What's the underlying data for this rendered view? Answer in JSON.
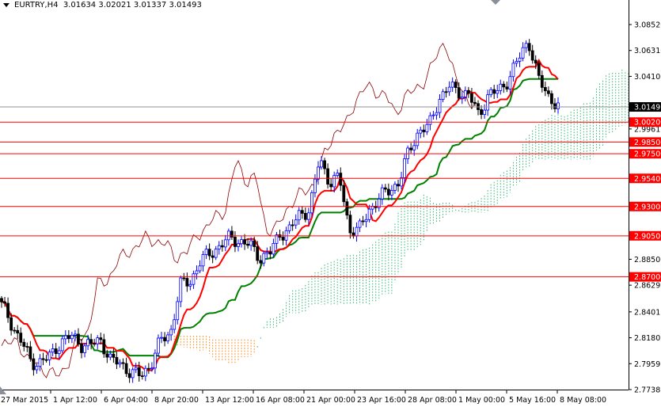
{
  "header": {
    "symbol": "EURTRY,H4",
    "open": "3.01634",
    "high": "3.02021",
    "low": "3.01337",
    "close": "3.01493"
  },
  "chart_data": {
    "type": "candlestick",
    "title": "EURTRY,H4",
    "ylim": [
      2.77385,
      3.0852
    ],
    "y_ticks": [
      "3.08520",
      "3.06310",
      "3.04100",
      "2.99615",
      "2.88500",
      "2.86290",
      "2.84015",
      "2.81805",
      "2.79595",
      "2.77385"
    ],
    "x_ticks": [
      "27 Mar 2015",
      "1 Apr 12:00",
      "6 Apr 04:00",
      "8 Apr 20:00",
      "13 Apr 12:00",
      "16 Apr 08:00",
      "21 Apr 00:00",
      "23 Apr 16:00",
      "28 Apr 08:00",
      "1 May 00:00",
      "5 May 16:00",
      "8 May 08:00"
    ],
    "close_path": [
      2.8461,
      2.8292,
      2.8157,
      2.7955,
      2.7988,
      2.8022,
      2.8157,
      2.8191,
      2.8123,
      2.8123,
      2.8157,
      2.7988,
      2.7955,
      2.7887,
      2.7853,
      2.7955,
      2.8157,
      2.8225,
      2.863,
      2.8664,
      2.8833,
      2.89,
      2.8968,
      2.9035,
      2.9001,
      2.8968,
      2.8866,
      2.89,
      2.9069,
      2.9103,
      2.9238,
      2.9272,
      2.9711,
      2.9508,
      2.9542,
      2.9103,
      2.9103,
      2.9272,
      2.9373,
      2.944,
      2.9508,
      2.9778,
      2.9947,
      2.9981,
      3.0217,
      3.0318,
      3.0285,
      3.0251,
      3.0082,
      3.0251,
      3.0285,
      3.0386,
      3.0555,
      3.0724,
      3.0386,
      3.0251,
      3.015
    ],
    "indicator": "Ichimoku Kinko Hyo (9,26,52)",
    "current_price": {
      "value": 3.01493,
      "label": "3.01493",
      "color": "#000000"
    },
    "levels": [
      {
        "value": 3.002,
        "label": "3.00200"
      },
      {
        "value": 2.985,
        "label": "2.98500"
      },
      {
        "value": 2.975,
        "label": "2.97500"
      },
      {
        "value": 2.954,
        "label": "2.95400"
      },
      {
        "value": 2.93,
        "label": "2.93000"
      },
      {
        "value": 2.905,
        "label": "2.90500"
      },
      {
        "value": 2.87,
        "label": "2.87000"
      }
    ],
    "colors": {
      "level": "#ff0000",
      "tenkan": "#ff0000",
      "kijun": "#008000",
      "chikou": "#8b0000",
      "cloud_up": "#2eb872",
      "cloud_down": "#ff7f00",
      "bull": "#0000ff",
      "bear": "#000000"
    }
  }
}
